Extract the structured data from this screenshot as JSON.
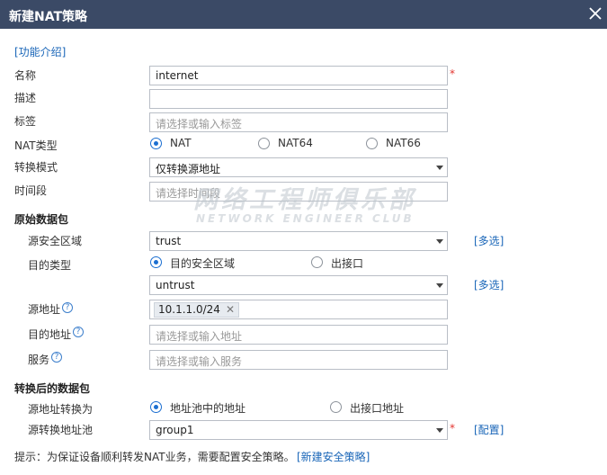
{
  "dialog": {
    "title": "新建NAT策略"
  },
  "intro_link": "[功能介绍]",
  "fields": {
    "name_label": "名称",
    "name_value": "internet",
    "required_mark": "*",
    "desc_label": "描述",
    "tag_label": "标签",
    "tag_placeholder": "请选择或输入标签",
    "nat_type_label": "NAT类型",
    "nat_types": [
      "NAT",
      "NAT64",
      "NAT66"
    ],
    "nat_type_selected": "NAT",
    "mode_label": "转换模式",
    "mode_value": "仅转换源地址",
    "time_label": "时间段",
    "time_placeholder": "请选择时间段"
  },
  "original": {
    "section_title": "原始数据包",
    "src_zone_label": "源安全区域",
    "src_zone_value": "trust",
    "multi_select": "[多选]",
    "dest_type_label": "目的类型",
    "dest_type_options": [
      "目的安全区域",
      "出接口"
    ],
    "dest_type_selected": "目的安全区域",
    "dest_zone_value": "untrust",
    "src_addr_label": "源地址",
    "src_addr_tag": "10.1.1.0/24",
    "dest_addr_label": "目的地址",
    "dest_addr_placeholder": "请选择或输入地址",
    "service_label": "服务",
    "service_placeholder": "请选择或输入服务"
  },
  "translated": {
    "section_title": "转换后的数据包",
    "src_convert_label": "源地址转换为",
    "convert_options": [
      "地址池中的地址",
      "出接口地址"
    ],
    "convert_selected": "地址池中的地址",
    "pool_label": "源转换地址池",
    "pool_value": "group1",
    "config_link": "[配置]"
  },
  "footer": {
    "tip": "提示：为保证设备顺利转发NAT业务，需要配置安全策略。",
    "new_policy_link": "[新建安全策略]"
  },
  "watermark": {
    "line1": "网络工程师俱乐部",
    "line2": "NETWORK ENGINEER CLUB"
  },
  "colors": {
    "titlebar": "#3b4a66",
    "link": "#1a66b8",
    "radio_selected": "#1c6fd1",
    "required": "#e3342f"
  }
}
